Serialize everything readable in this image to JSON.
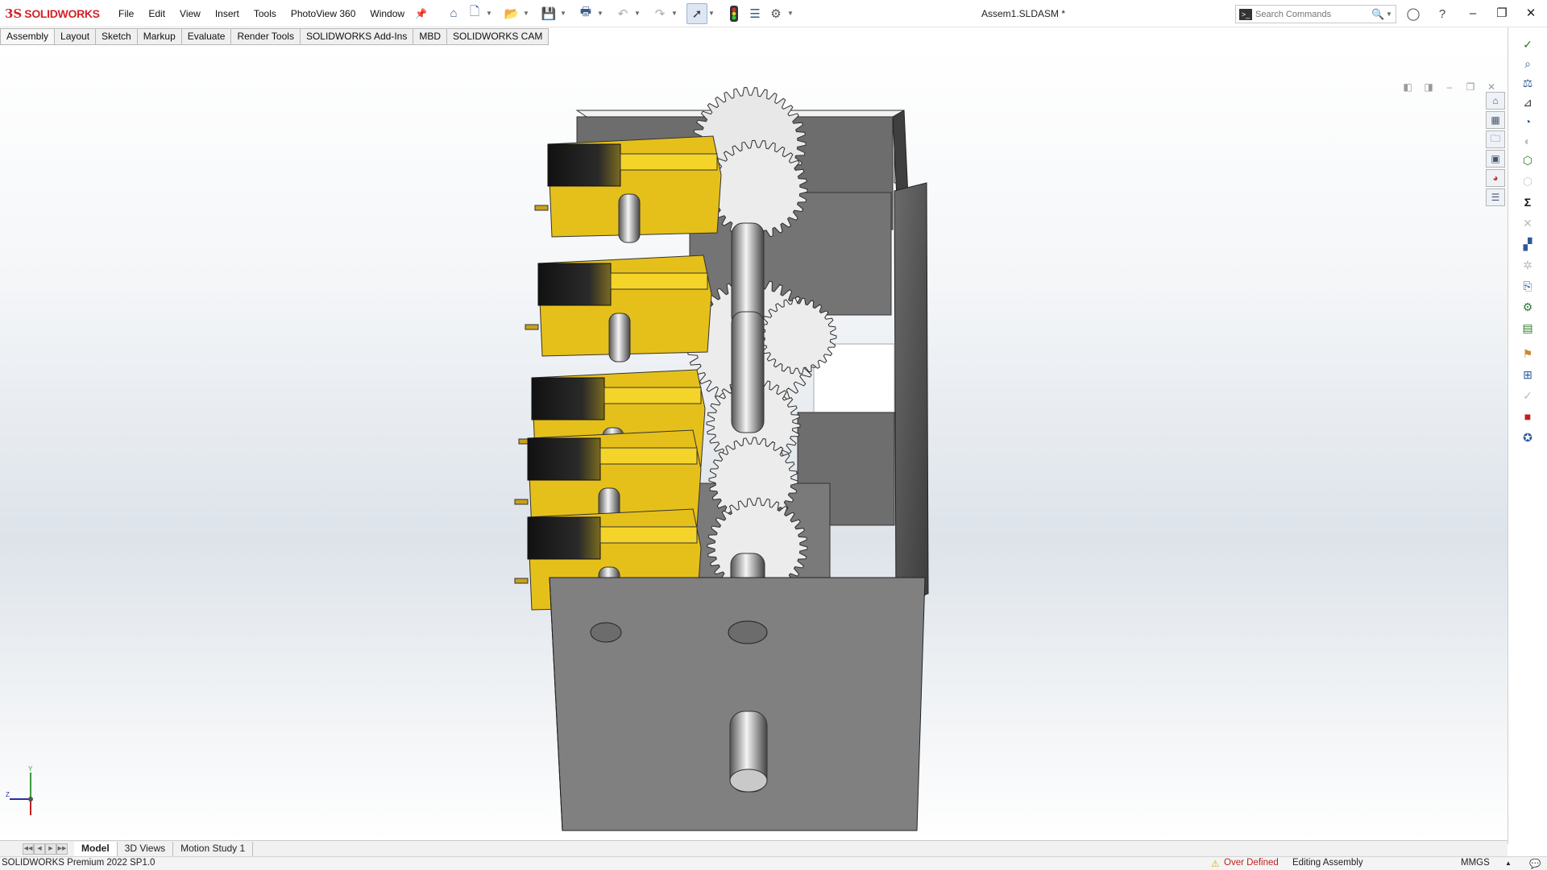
{
  "app": {
    "brand": "SOLIDWORKS",
    "logo_symbol": "3S",
    "document_title": "Assem1.SLDASM *"
  },
  "menu": [
    "File",
    "Edit",
    "View",
    "Insert",
    "Tools",
    "PhotoView 360",
    "Window"
  ],
  "toolbar": {
    "icons": [
      "home-icon",
      "new-document-icon",
      "open-icon",
      "save-icon",
      "print-icon",
      "undo-icon",
      "redo-icon",
      "select-icon",
      "rebuild-traffic-light-icon",
      "file-properties-icon",
      "options-gear-icon"
    ]
  },
  "search": {
    "placeholder": "Search Commands",
    "terminal_glyph": ">_"
  },
  "title_icons": [
    "user-account-icon",
    "help-icon"
  ],
  "window_controls": {
    "minimize": "–",
    "restore": "❐",
    "close": "✕"
  },
  "command_tabs": [
    "Assembly",
    "Layout",
    "Sketch",
    "Markup",
    "Evaluate",
    "Render Tools",
    "SOLIDWORKS Add-Ins",
    "MBD",
    "SOLIDWORKS CAM"
  ],
  "headsup_icons": [
    "zoom-to-fit-icon",
    "zoom-to-area-icon",
    "previous-view-icon",
    "section-view-icon",
    "dynamic-annotation-icon",
    "view-orientation-icon",
    "display-style-icon",
    "hide-show-items-icon",
    "edit-appearance-icon",
    "apply-scene-icon",
    "view-settings-icon"
  ],
  "bottom_tabs": [
    "Model",
    "3D Views",
    "Motion Study 1"
  ],
  "status": {
    "product": "SOLIDWORKS Premium 2022 SP1.0",
    "over_defined": "Over Defined",
    "mode": "Editing Assembly",
    "units": "MMGS"
  },
  "triad": {
    "x": "Z",
    "y": "Y"
  },
  "colors": {
    "brand_red": "#d2232a",
    "part_yellow": "#e6c01a",
    "housing_gray": "#808080",
    "status_error": "#c02020"
  }
}
